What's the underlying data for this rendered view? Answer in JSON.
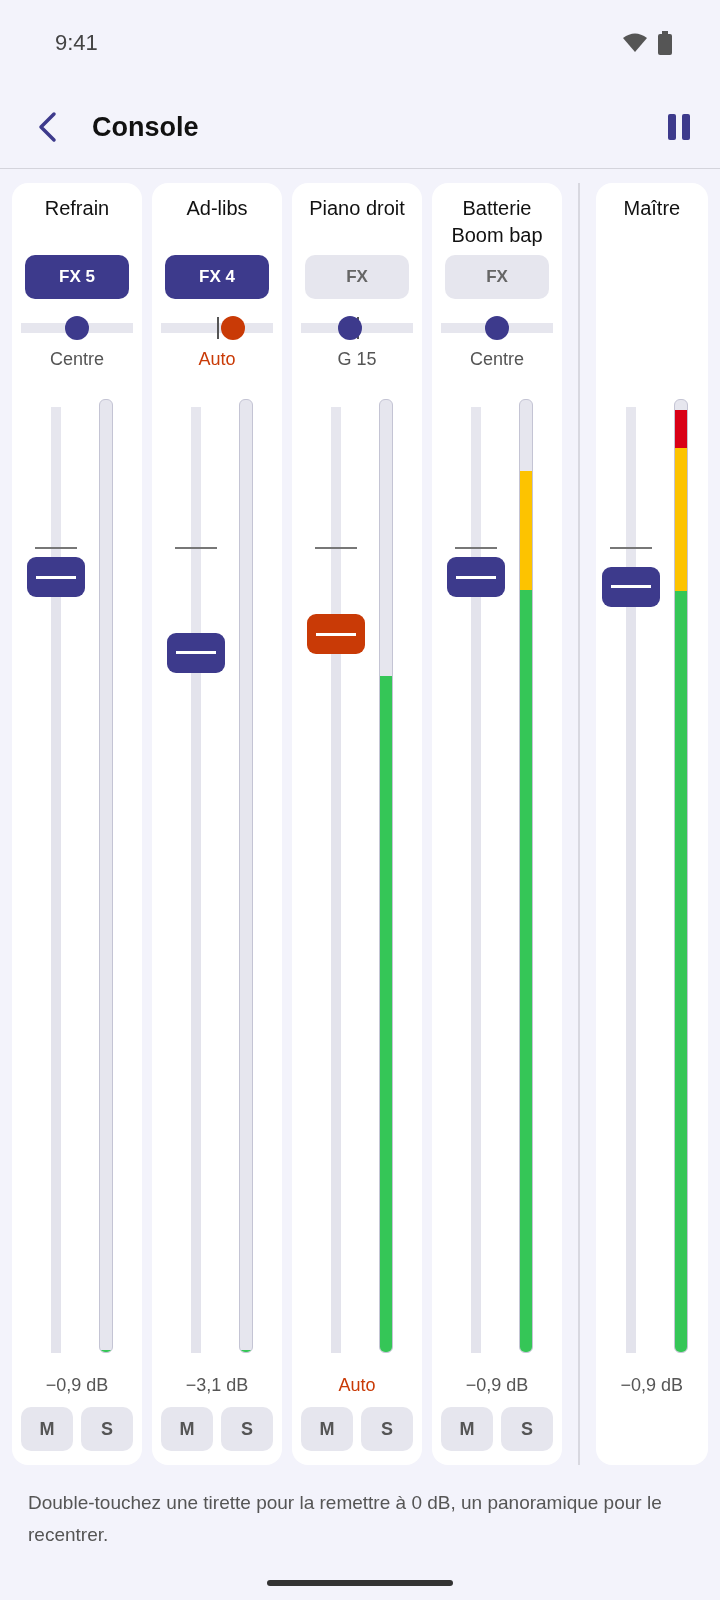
{
  "status_bar": {
    "time": "9:41"
  },
  "app_bar": {
    "title": "Console"
  },
  "strips": [
    {
      "kind": "channel",
      "name": "Refrain",
      "fx": {
        "label": "FX 5",
        "active": true
      },
      "pan": {
        "level": 0.5,
        "auto": false,
        "reading": "Centre"
      },
      "fader": {
        "level": 0.82,
        "auto": false,
        "reading": "−0,9 dB"
      },
      "meter": {
        "level": 0
      },
      "mute": "M",
      "solo": "S"
    },
    {
      "kind": "channel",
      "name": "Ad-libs",
      "fx": {
        "label": "FX 4",
        "active": true
      },
      "pan": {
        "level": 0.63,
        "auto": true,
        "reading": "Auto"
      },
      "fader": {
        "level": 0.74,
        "auto": false,
        "reading": "−3,1 dB"
      },
      "meter": {
        "level": 0
      },
      "mute": "M",
      "solo": "S"
    },
    {
      "kind": "channel",
      "name": "Piano droit",
      "fx": {
        "label": "FX",
        "active": false
      },
      "pan": {
        "level": 0.44,
        "auto": false,
        "reading": "G 15"
      },
      "fader": {
        "level": 0.76,
        "auto": true,
        "reading": "Auto"
      },
      "meter": {
        "level": 0.71
      },
      "mute": "M",
      "solo": "S"
    },
    {
      "kind": "channel",
      "name": "Batterie Boom bap",
      "fx": {
        "label": "FX",
        "active": false
      },
      "pan": {
        "level": 0.5,
        "auto": false,
        "reading": "Centre"
      },
      "fader": {
        "level": 0.82,
        "auto": false,
        "reading": "−0,9 dB"
      },
      "meter": {
        "level": 0.925
      },
      "mute": "M",
      "solo": "S"
    },
    {
      "kind": "master",
      "name": "Maître",
      "fader": {
        "level": 0.81,
        "auto": false,
        "reading": "−0,9 dB"
      },
      "meter": {
        "level": 0.99
      }
    }
  ],
  "hint": "Double-touchez une tirette pour la remettre à 0 dB, un panoramique pour le recentrer."
}
